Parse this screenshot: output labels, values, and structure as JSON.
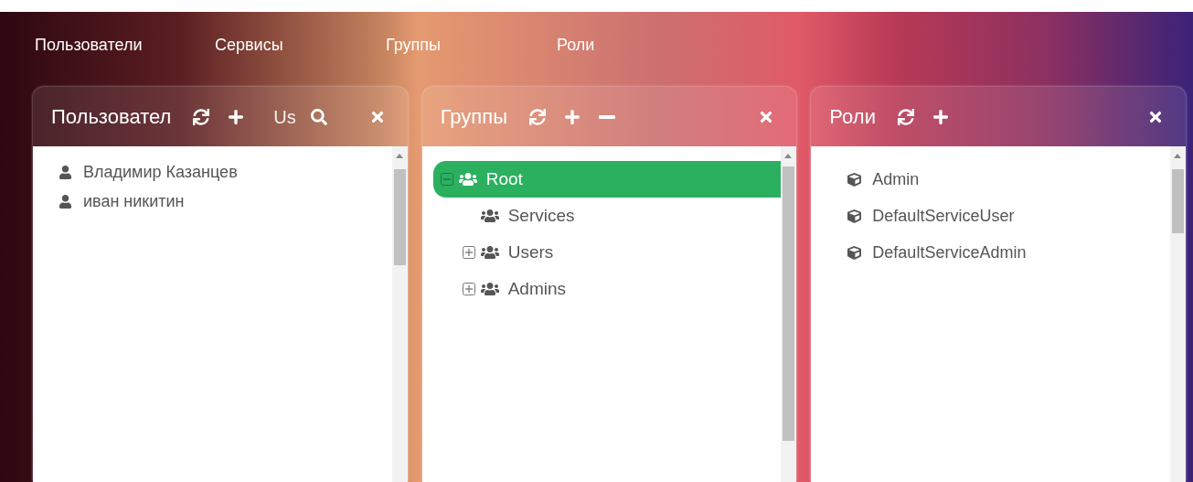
{
  "nav": [
    {
      "label": "Пользователи"
    },
    {
      "label": "Сервисы"
    },
    {
      "label": "Группы"
    },
    {
      "label": "Роли"
    }
  ],
  "panels": [
    {
      "title": "Пользовател",
      "tools": [
        {
          "kind": "refresh"
        },
        {
          "kind": "add"
        },
        {
          "kind": "text",
          "text": "Us"
        },
        {
          "kind": "search"
        }
      ],
      "kind": "users",
      "items": [
        {
          "label": "Владимир Казанцев"
        },
        {
          "label": "иван никитин"
        }
      ]
    },
    {
      "title": "Группы",
      "tools": [
        {
          "kind": "refresh"
        },
        {
          "kind": "add"
        },
        {
          "kind": "remove"
        }
      ],
      "kind": "tree",
      "items": [
        {
          "label": "Root",
          "selected": true,
          "expanded": true,
          "children": [
            {
              "label": "Services",
              "selected": false
            },
            {
              "label": "Users",
              "selected": false,
              "expanded": false
            },
            {
              "label": "Admins",
              "selected": false,
              "expanded": false
            }
          ]
        }
      ]
    },
    {
      "title": "Роли",
      "tools": [
        {
          "kind": "refresh"
        },
        {
          "kind": "add"
        }
      ],
      "kind": "roles",
      "items": [
        {
          "label": "Admin"
        },
        {
          "label": "DefaultServiceUser"
        },
        {
          "label": "DefaultServiceAdmin"
        }
      ]
    }
  ]
}
